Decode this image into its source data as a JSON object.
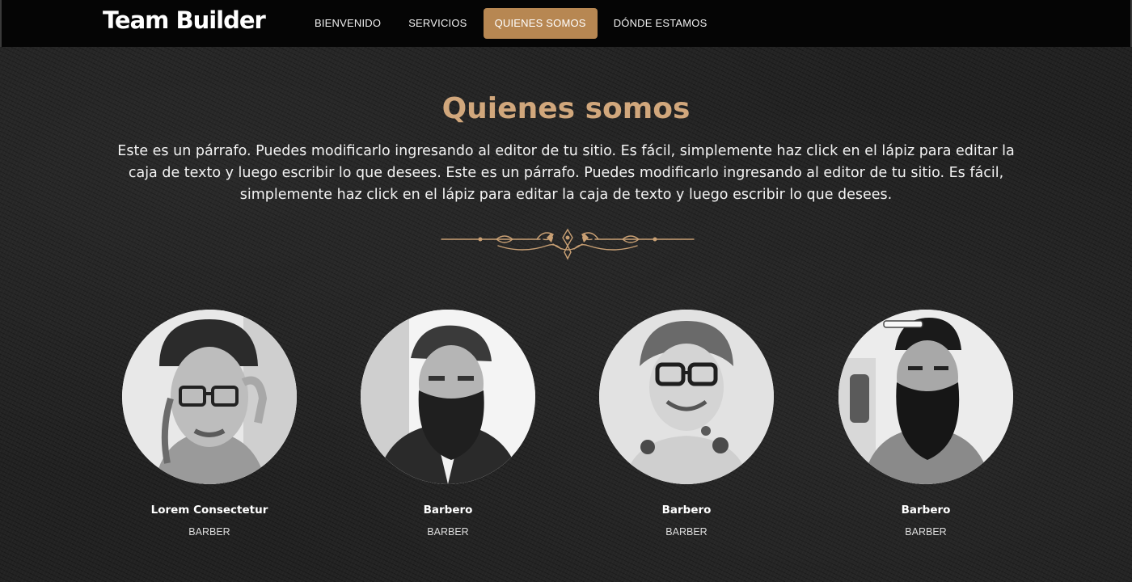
{
  "brand": "Team Builder",
  "nav": {
    "items": [
      "BIENVENIDO",
      "SERVICIOS",
      "QUIENES SOMOS",
      "DÓNDE ESTAMOS"
    ],
    "active_index": 2
  },
  "section": {
    "title": "Quienes somos",
    "intro": "Este es un párrafo. Puedes modificarlo ingresando al editor de tu sitio. Es fácil, simplemente haz click en el lápiz para editar la caja de texto y luego escribir lo que desees. Este es un párrafo. Puedes modificarlo ingresando al editor de tu sitio. Es fácil, simplemente haz click en el lápiz para editar la caja de texto y luego escribir lo que desees."
  },
  "team": [
    {
      "name": "Lorem Consectetur",
      "role": "BARBER",
      "photo": "man-with-beanie-and-glasses-photo"
    },
    {
      "name": "Barbero",
      "role": "BARBER",
      "photo": "bearded-man-in-vest-photo"
    },
    {
      "name": "Barbero",
      "role": "BARBER",
      "photo": "woman-with-glasses-and-tattoos-photo"
    },
    {
      "name": "Barbero",
      "role": "BARBER",
      "photo": "bearded-man-with-razor-photo"
    }
  ],
  "colors": {
    "accent": "#b78752",
    "title": "#d1a77c",
    "navbar": "#050505",
    "background": "#222222"
  }
}
